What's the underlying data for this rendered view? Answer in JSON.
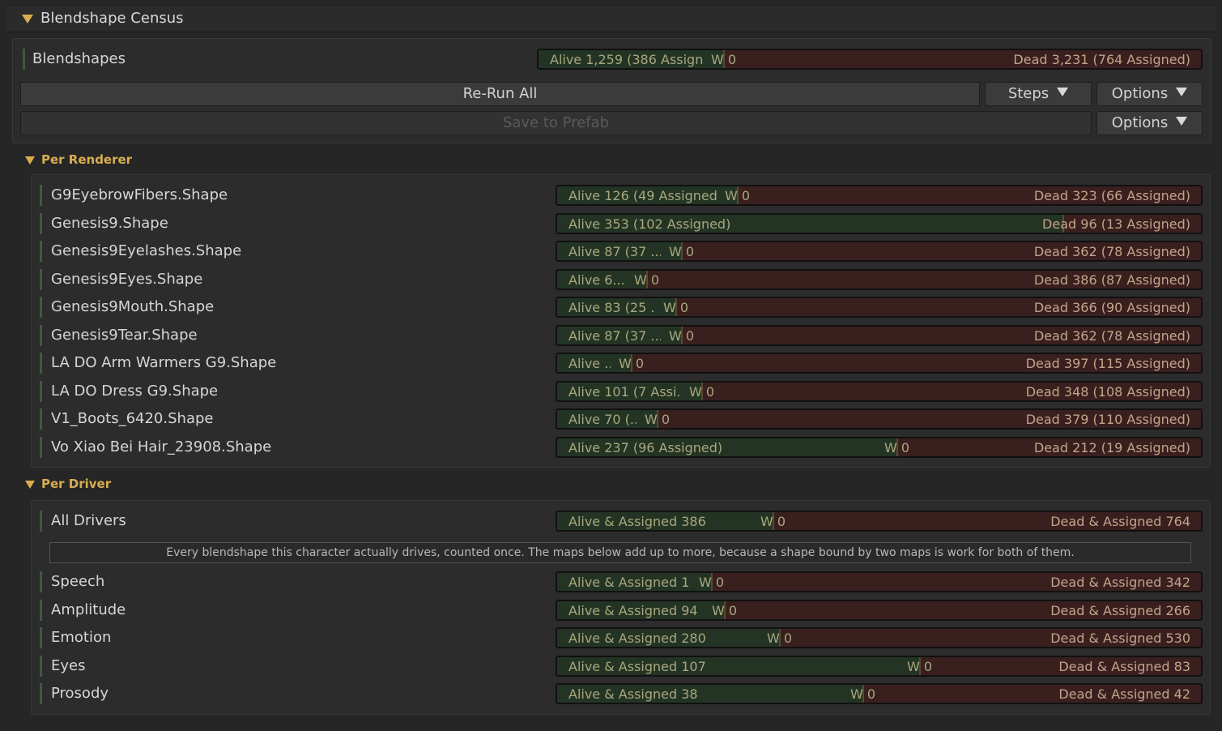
{
  "panel": {
    "title": "Blendshape Census"
  },
  "summary": {
    "label": "Blendshapes",
    "alive_text": "Alive 1,259 (386 Assign...",
    "w_text": "W 0",
    "dead_text": "Dead 3,231 (764 Assigned)",
    "alive_fraction": 0.28
  },
  "buttons": {
    "rerun": "Re-Run All",
    "steps": "Steps",
    "options_1": "Options",
    "save": "Save to Prefab",
    "options_2": "Options"
  },
  "per_renderer": {
    "title": "Per Renderer",
    "rows": [
      {
        "label": "G9EyebrowFibers.Shape",
        "alive_text": "Alive 126 (49 Assigned)",
        "w_text": "W 0",
        "dead_text": "Dead 323 (66 Assigned)",
        "alive_fraction": 0.28
      },
      {
        "label": "Genesis9.Shape",
        "alive_text": "Alive 353 (102 Assigned)",
        "w_text": "",
        "dead_text": "Dead 96 (13 Assigned)",
        "alive_fraction": 0.786
      },
      {
        "label": "Genesis9Eyelashes.Shape",
        "alive_text": "Alive 87 (37 ...",
        "w_text": "W 0",
        "dead_text": "Dead 362 (78 Assigned)",
        "alive_fraction": 0.194
      },
      {
        "label": "Genesis9Eyes.Shape",
        "alive_text": "Alive 6...",
        "w_text": "W 0",
        "dead_text": "Dead 386 (87 Assigned)",
        "alive_fraction": 0.14
      },
      {
        "label": "Genesis9Mouth.Shape",
        "alive_text": "Alive 83 (25 ...",
        "w_text": "W 0",
        "dead_text": "Dead 366 (90 Assigned)",
        "alive_fraction": 0.185
      },
      {
        "label": "Genesis9Tear.Shape",
        "alive_text": "Alive 87 (37 ...",
        "w_text": "W 0",
        "dead_text": "Dead 362 (78 Assigned)",
        "alive_fraction": 0.194
      },
      {
        "label": "LA DO Arm Warmers G9.Shape",
        "alive_text": "Alive ...",
        "w_text": "W 0",
        "dead_text": "Dead 397 (115 Assigned)",
        "alive_fraction": 0.116
      },
      {
        "label": "LA DO Dress G9.Shape",
        "alive_text": "Alive 101 (7 Assi...",
        "w_text": "W 0",
        "dead_text": "Dead 348 (108 Assigned)",
        "alive_fraction": 0.225
      },
      {
        "label": "V1_Boots_6420.Shape",
        "alive_text": "Alive 70 (...",
        "w_text": "W 0",
        "dead_text": "Dead 379 (110 Assigned)",
        "alive_fraction": 0.156
      },
      {
        "label": "Vo Xiao Bei Hair_23908.Shape",
        "alive_text": "Alive 237 (96 Assigned)",
        "w_text": "W 0",
        "dead_text": "Dead 212 (19 Assigned)",
        "alive_fraction": 0.528
      }
    ]
  },
  "per_driver": {
    "title": "Per Driver",
    "all": {
      "label": "All Drivers",
      "alive_text": "Alive & Assigned 386",
      "w_text": "W 0",
      "dead_text": "Dead & Assigned 764",
      "alive_fraction": 0.336
    },
    "note": "Every blendshape this character actually drives, counted once. The maps below add up to more, because a shape bound by two maps is work for both of them.",
    "rows": [
      {
        "label": "Speech",
        "alive_text": "Alive & Assigned 1...",
        "w_text": "W 0",
        "dead_text": "Dead & Assigned 342",
        "alive_fraction": 0.24
      },
      {
        "label": "Amplitude",
        "alive_text": "Alive & Assigned 94",
        "w_text": "W 0",
        "dead_text": "Dead & Assigned 266",
        "alive_fraction": 0.261
      },
      {
        "label": "Emotion",
        "alive_text": "Alive & Assigned 280",
        "w_text": "W 0",
        "dead_text": "Dead & Assigned 530",
        "alive_fraction": 0.346
      },
      {
        "label": "Eyes",
        "alive_text": "Alive & Assigned 107",
        "w_text": "W 0",
        "dead_text": "Dead & Assigned 83",
        "alive_fraction": 0.563
      },
      {
        "label": "Prosody",
        "alive_text": "Alive & Assigned 38",
        "w_text": "W 0",
        "dead_text": "Dead & Assigned 42",
        "alive_fraction": 0.475
      }
    ]
  }
}
